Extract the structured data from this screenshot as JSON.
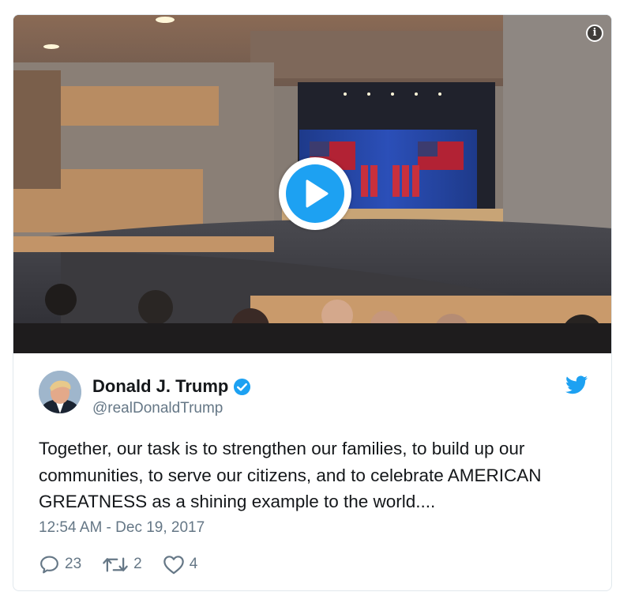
{
  "user": {
    "display_name": "Donald J. Trump",
    "handle": "@realDonaldTrump",
    "verified": true
  },
  "tweet": {
    "text_line1": "Together, our task is to strengthen our families, to build up our",
    "text_line2": "communities, to serve our citizens, and to celebrate AMERICAN",
    "text_line3": "GREATNESS as a shining example to the world....",
    "timestamp": "12:54 AM - Dec 19, 2017"
  },
  "actions": {
    "replies": "23",
    "retweets": "2",
    "likes": "4"
  },
  "colors": {
    "accent": "#1da1f2",
    "text": "#14171a",
    "muted": "#657786",
    "border": "#e1e8ed"
  },
  "icons": [
    "info-icon",
    "play-icon",
    "verified-badge-icon",
    "twitter-bird-icon",
    "reply-icon",
    "retweet-icon",
    "like-heart-icon"
  ]
}
